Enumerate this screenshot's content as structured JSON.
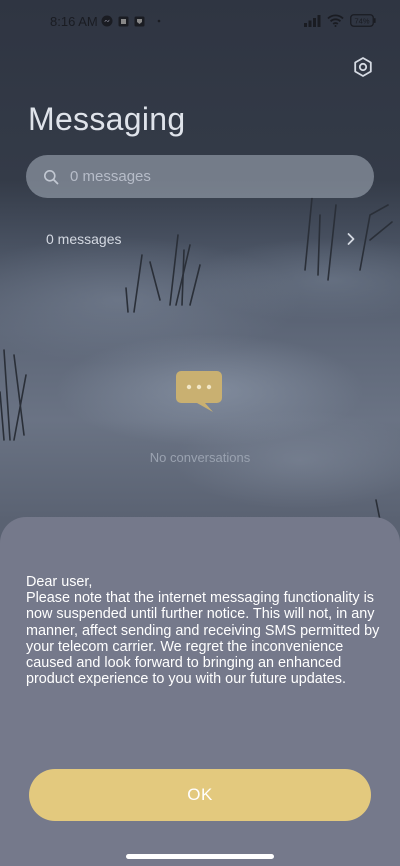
{
  "status_bar": {
    "time": "8:16 AM",
    "battery_level": "74%",
    "icons": [
      "messenger-icon",
      "app-icon",
      "app-icon",
      "dot-icon",
      "signal-icon",
      "wifi-icon",
      "battery-icon"
    ]
  },
  "header": {
    "title": "Messaging",
    "settings_icon": "gear-icon"
  },
  "search": {
    "placeholder": "0 messages"
  },
  "messages_row": {
    "label": "0 messages",
    "icon": "chevron-right-icon"
  },
  "empty_state": {
    "icon": "chat-bubble-icon",
    "text": "No conversations"
  },
  "dialog": {
    "greeting": "Dear user,",
    "body": "Please note that the internet messaging functionality is now suspended until further notice. This will not, in any manner, affect sending and receiving SMS permitted by your telecom carrier. We regret the inconvenience caused and look forward to bringing an enhanced product experience to you with our future updates.",
    "ok_label": "OK"
  },
  "colors": {
    "accent": "#e3c97e",
    "sheet_background": "#75798b",
    "title_text": "#dfe3ea"
  }
}
